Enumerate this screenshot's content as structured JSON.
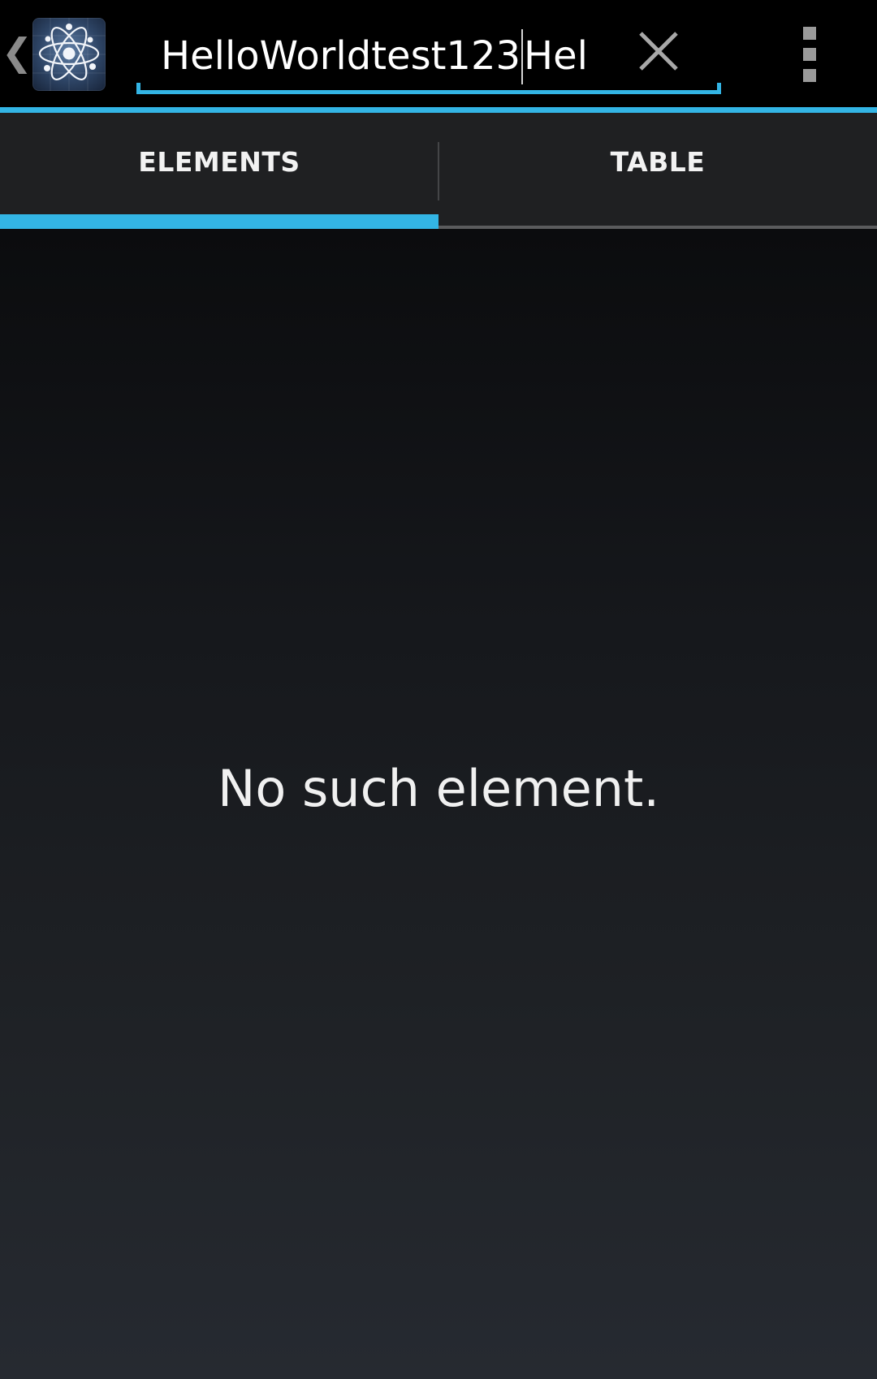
{
  "action_bar": {
    "up_caret_glyph": "❮",
    "app_icon": "atom-icon",
    "search": {
      "value_before_cursor": "HelloWorldtest123",
      "value_after_cursor": "Hel",
      "accent_color": "#33b5e5"
    },
    "clear_icon": "close-icon",
    "overflow_icon": "overflow-menu-icon"
  },
  "tabs": [
    {
      "label": "ELEMENTS",
      "selected": true
    },
    {
      "label": "TABLE",
      "selected": false
    }
  ],
  "content": {
    "empty_message": "No such element."
  },
  "colors": {
    "accent": "#33b5e5",
    "action_bar_bg": "#000000",
    "tab_bar_bg": "#1f2022"
  }
}
